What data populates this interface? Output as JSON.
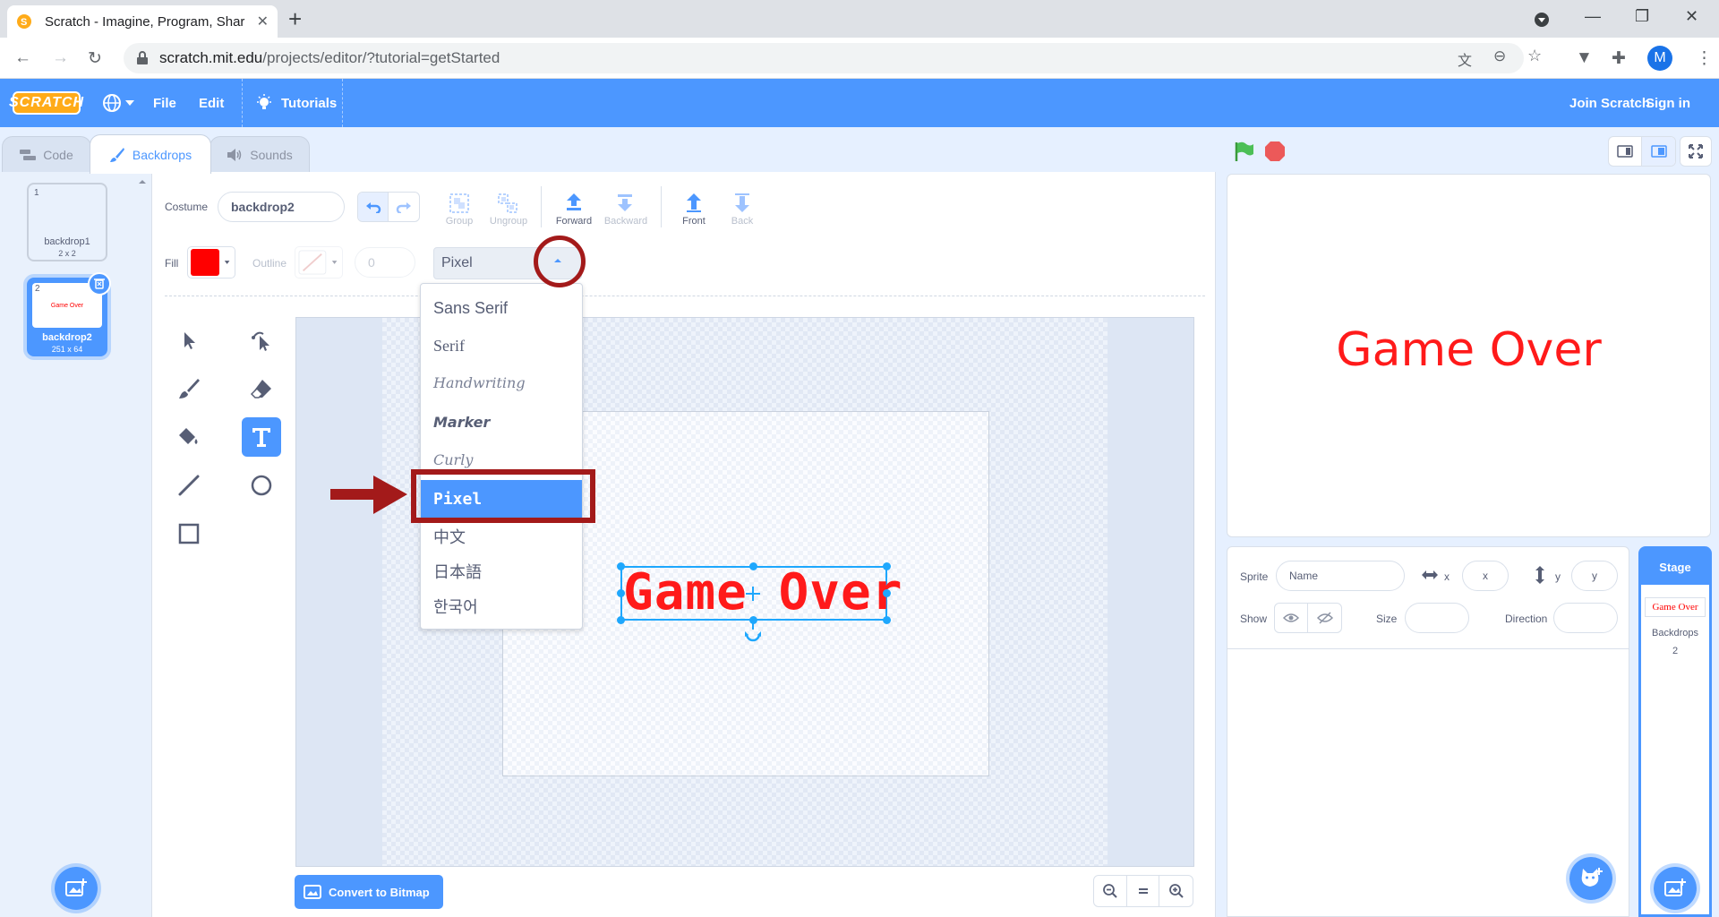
{
  "browser": {
    "tab_title": "Scratch - Imagine, Program, Shar",
    "url_host": "scratch.mit.edu",
    "url_path": "/projects/editor/?tutorial=getStarted",
    "avatar_letter": "M"
  },
  "menubar": {
    "logo": "SCRATCH",
    "file": "File",
    "edit": "Edit",
    "tutorials": "Tutorials",
    "join": "Join Scratch",
    "signin": "Sign in"
  },
  "tabs": {
    "code": "Code",
    "backdrops": "Backdrops",
    "sounds": "Sounds"
  },
  "costumes": [
    {
      "num": "1",
      "name": "backdrop1",
      "size": "2 x 2"
    },
    {
      "num": "2",
      "name": "backdrop2",
      "size": "251 x 64",
      "thumb_text": "Game Over"
    }
  ],
  "paint": {
    "costume_label": "Costume",
    "costume_name": "backdrop2",
    "group": "Group",
    "ungroup": "Ungroup",
    "forward": "Forward",
    "backward": "Backward",
    "front": "Front",
    "back": "Back",
    "fill_label": "Fill",
    "outline_label": "Outline",
    "outline_width": "0",
    "font_selected": "Pixel",
    "convert": "Convert to Bitmap",
    "canvas_text": "Game Over",
    "fill_color": "#ff0000"
  },
  "font_options": [
    "Sans Serif",
    "Serif",
    "Handwriting",
    "Marker",
    "Curly",
    "Pixel",
    "中文",
    "日本語",
    "한국어"
  ],
  "stage": {
    "text": "Game Over"
  },
  "sprite": {
    "sprite_label": "Sprite",
    "name_placeholder": "Name",
    "x_label": "x",
    "x_placeholder": "x",
    "y_label": "y",
    "y_placeholder": "y",
    "show_label": "Show",
    "size_label": "Size",
    "direction_label": "Direction"
  },
  "stage_panel": {
    "title": "Stage",
    "thumb_text": "Game Over",
    "backdrops_label": "Backdrops",
    "backdrops_count": "2"
  },
  "colors": {
    "accent": "#4c97ff",
    "annotation": "#a31a1a",
    "text_red": "#ff1a1a"
  }
}
